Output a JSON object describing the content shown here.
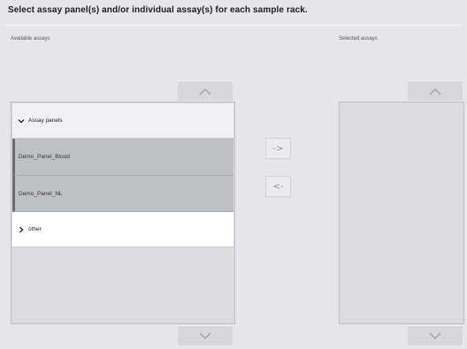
{
  "header": {
    "title": "Select assay panel(s) and/or individual assay(s) for each sample rack."
  },
  "available": {
    "label": "Available assays",
    "groups": [
      {
        "label": "Assay panels",
        "expanded": true
      },
      {
        "label": "Demo_Panel_Blood"
      },
      {
        "label": "Demo_Panel_NL"
      },
      {
        "label": "other",
        "expanded": false
      }
    ]
  },
  "selected": {
    "label": "Selected assays",
    "items": []
  },
  "transfer": {
    "add_label": "->",
    "remove_label": "<-"
  },
  "icons": {
    "scroll_up": "chevron-up-icon",
    "scroll_down": "chevron-down-icon",
    "expanded": "chevron-down-icon",
    "collapsed": "chevron-right-icon"
  }
}
